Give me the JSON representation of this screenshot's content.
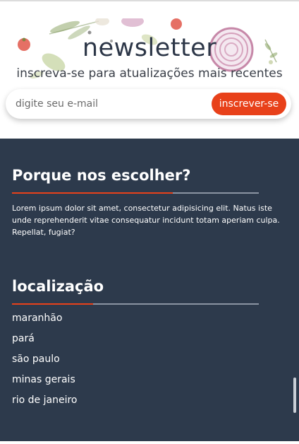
{
  "newsletter": {
    "title": "newsletter",
    "subtitle": "inscreva-se para atualizações mais recentes",
    "email_placeholder": "digite seu e-mail",
    "subscribe_label": "inscrever-se"
  },
  "footer": {
    "why_heading": "Porque nos escolher?",
    "why_text": "Lorem ipsum dolor sit amet, consectetur adipisicing elit. Natus iste unde reprehenderit vitae consequatur incidunt totam aperiam culpa. Repellat, fugiat?",
    "location_heading": "localização",
    "locations": [
      "maranhão",
      "pará",
      "são paulo",
      "minas gerais",
      "rio de janeiro"
    ]
  },
  "colors": {
    "accent": "#e8411a",
    "footer_bg": "#2d3a4c",
    "heading_text": "#2d3748"
  }
}
